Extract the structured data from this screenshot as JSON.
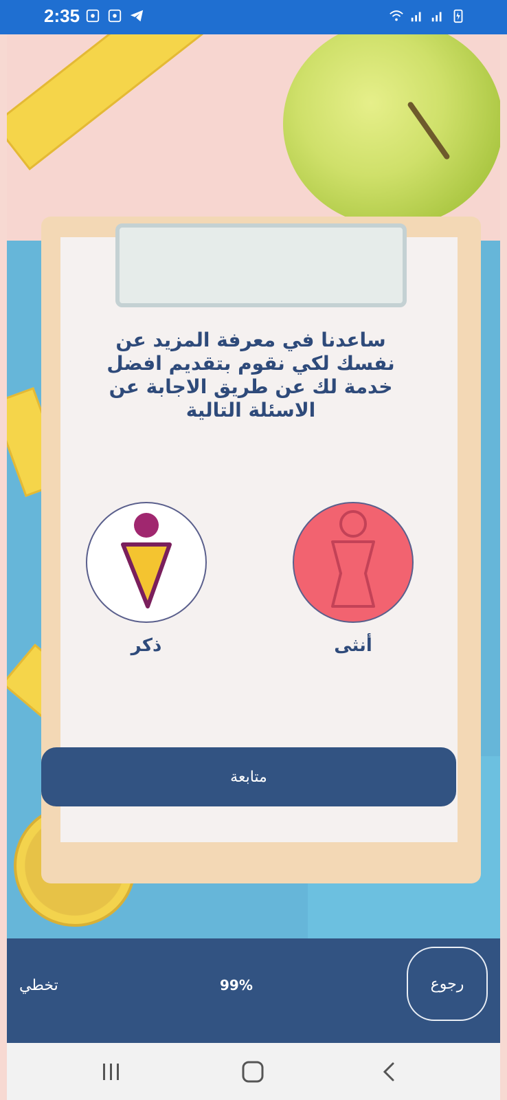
{
  "status_bar": {
    "time": "2:35",
    "left_icons": [
      "screen-record-icon",
      "screen-record-icon",
      "telegram-icon"
    ],
    "right_icons": [
      "wifi-icon",
      "signal-icon",
      "signal-icon",
      "battery-charging-icon"
    ]
  },
  "main": {
    "heading": "ساعدنا في معرفة المزيد عن نفسك لكي نقوم بتقديم افضل خدمة لك عن طريق الاجابة عن الاسئلة التالية",
    "options": [
      {
        "label": "ذكر",
        "icon": "male-icon"
      },
      {
        "label": "أنثى",
        "icon": "female-icon"
      }
    ],
    "continue_label": "متابعة"
  },
  "bottom_bar": {
    "skip_label": "تخطي",
    "progress": "99%",
    "back_label": "رجوع"
  },
  "system_nav": {
    "icons": [
      "recent-apps-icon",
      "home-icon",
      "back-icon"
    ]
  },
  "colors": {
    "status_bar": "#1f6fd1",
    "primary": "#325382",
    "female": "#f26370",
    "male_accent": "#f4c430",
    "male_head": "#a0276f"
  }
}
